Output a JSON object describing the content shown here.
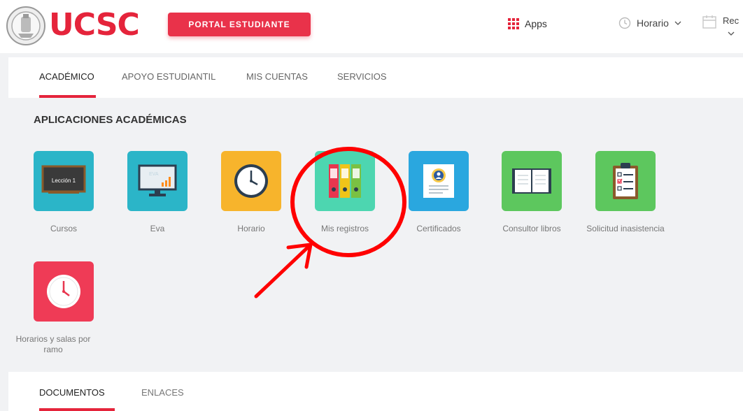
{
  "header": {
    "brand": "UCSC",
    "portal_button": "PORTAL ESTUDIANTE",
    "apps_label": "Apps",
    "horario_label": "Horario",
    "recursos_label": "Rec"
  },
  "nav": {
    "tabs": [
      {
        "label": "ACADÉMICO",
        "active": true
      },
      {
        "label": "APOYO ESTUDIANTIL",
        "active": false
      },
      {
        "label": "MIS CUENTAS",
        "active": false
      },
      {
        "label": "SERVICIOS",
        "active": false
      }
    ]
  },
  "section": {
    "title": "APLICACIONES ACADÉMICAS"
  },
  "apps": [
    {
      "label": "Cursos",
      "icon": "chalkboard-icon",
      "color": "#2bb5c8",
      "inner_text": "Lección 1"
    },
    {
      "label": "Eva",
      "icon": "monitor-chart-icon",
      "color": "#2bb5c8",
      "inner_text": "EVA"
    },
    {
      "label": "Horario",
      "icon": "clock-icon",
      "color": "#f7b42c"
    },
    {
      "label": "Mis registros",
      "icon": "binders-icon",
      "color": "#4dd6b0"
    },
    {
      "label": "Certificados",
      "icon": "certificate-icon",
      "color": "#2aa7df"
    },
    {
      "label": "Consultor libros",
      "icon": "open-book-icon",
      "color": "#5dc75e"
    },
    {
      "label": "Solicitud inasistencia",
      "icon": "clipboard-icon",
      "color": "#5dc75e"
    },
    {
      "label": "Horarios y salas por ramo",
      "icon": "clock-icon",
      "color": "#ef3b56"
    }
  ],
  "bottom_tabs": [
    {
      "label": "DOCUMENTOS",
      "active": true
    },
    {
      "label": "ENLACES",
      "active": false
    }
  ],
  "colors": {
    "brand_red": "#e5243b",
    "annotation_red": "#ff0000"
  }
}
